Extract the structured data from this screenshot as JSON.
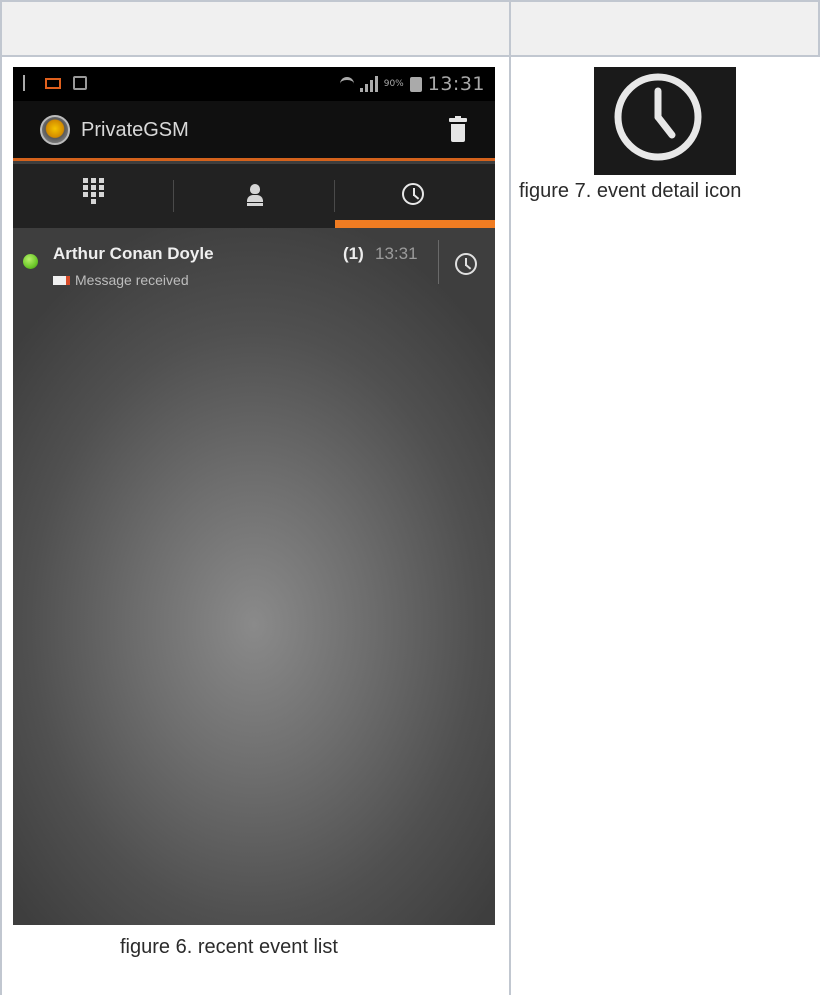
{
  "status_bar": {
    "battery_percent": "90%",
    "time": "13:31"
  },
  "app": {
    "title": "PrivateGSM"
  },
  "tabs": [
    {
      "icon": "dialpad-icon",
      "selected": false
    },
    {
      "icon": "contacts-icon",
      "selected": false
    },
    {
      "icon": "clock-icon",
      "selected": true
    }
  ],
  "events": [
    {
      "contact": "Arthur Conan Doyle",
      "count": "(1)",
      "time": "13:31",
      "detail": "Message received",
      "status_color": "#6cc82a"
    }
  ],
  "captions": {
    "figure6": "figure 6. recent event list",
    "figure7": "figure 7. event detail icon"
  },
  "colors": {
    "accent": "#f07c22",
    "action_bar_border": "#d4621c",
    "table_border": "#c1c7d0",
    "header_bg": "#f0f0f0"
  }
}
